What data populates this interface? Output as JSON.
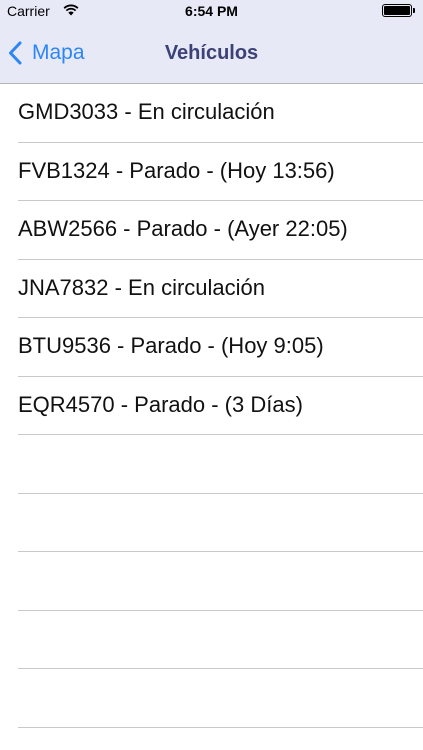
{
  "status_bar": {
    "carrier": "Carrier",
    "time": "6:54 PM",
    "wifi_icon": "wifi-icon",
    "battery_icon": "battery-icon",
    "battery_level": 1.0
  },
  "nav_bar": {
    "back_label": "Mapa",
    "back_icon": "chevron-left-icon",
    "title": "Vehículos",
    "colors": {
      "accent": "#2c86f5",
      "title": "#3c4277",
      "background": "#e7e9f6"
    }
  },
  "vehicles": [
    {
      "label": "GMD3033 - En circulación"
    },
    {
      "label": "FVB1324 - Parado - (Hoy 13:56)"
    },
    {
      "label": "ABW2566 - Parado - (Ayer 22:05)"
    },
    {
      "label": "JNA7832 - En circulación"
    },
    {
      "label": "BTU9536 - Parado - (Hoy 9:05)"
    },
    {
      "label": "EQR4570 - Parado - (3 Días)"
    }
  ]
}
